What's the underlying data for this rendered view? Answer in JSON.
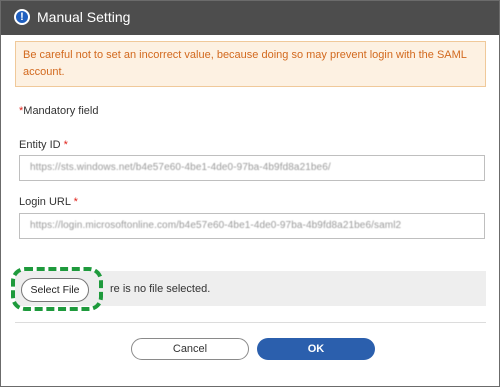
{
  "dialog": {
    "title": "Manual Setting",
    "title_icon": "exclamation-circle-icon"
  },
  "warning": {
    "text": "Be careful not to set an incorrect value, because doing so may prevent login with the SAML account."
  },
  "mandatory_note": {
    "star": "*",
    "text": "Mandatory field"
  },
  "fields": {
    "entity_id": {
      "label": "Entity ID",
      "star": " *",
      "value": "https://sts.windows.net/b4e57e60-4be1-4de0-97ba-4b9fd8a21be6/"
    },
    "login_url": {
      "label": "Login URL",
      "star": " *",
      "value": "https://login.microsoftonline.com/b4e57e60-4be1-4de0-97ba-4b9fd8a21be6/saml2"
    }
  },
  "file": {
    "button_label": "Select File",
    "status_text": "re is no file selected."
  },
  "buttons": {
    "cancel": "Cancel",
    "ok": "OK"
  },
  "colors": {
    "titlebar": "#4d4d4d",
    "warning_text": "#d2691e",
    "warning_bg": "#fdf1e2",
    "required_star": "#e0241c",
    "ok_button": "#2b5fad",
    "highlight_dashed": "#1e9a3c"
  }
}
